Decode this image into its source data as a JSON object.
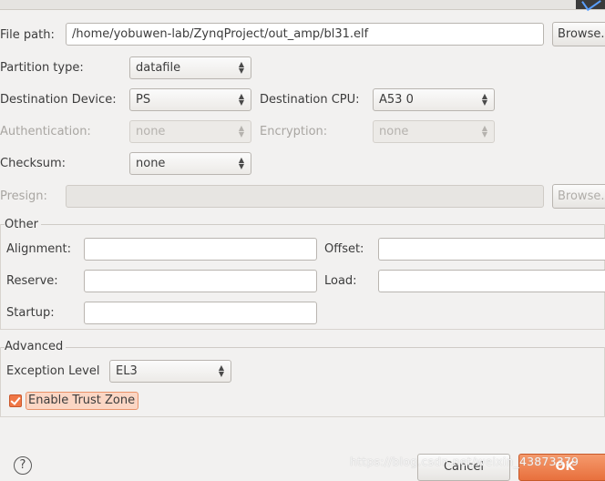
{
  "file_path": {
    "label": "File path:",
    "value": "/home/yobuwen-lab/ZynqProject/out_amp/bl31.elf",
    "browse": "Browse."
  },
  "partition_type": {
    "label": "Partition type:",
    "value": "datafile"
  },
  "destination_device": {
    "label": "Destination Device:",
    "value": "PS"
  },
  "destination_cpu": {
    "label": "Destination CPU:",
    "value": "A53 0"
  },
  "authentication": {
    "label": "Authentication:",
    "value": "none"
  },
  "encryption": {
    "label": "Encryption:",
    "value": "none"
  },
  "checksum": {
    "label": "Checksum:",
    "value": "none"
  },
  "presign": {
    "label": "Presign:",
    "value": "",
    "browse": "Browse."
  },
  "other": {
    "title": "Other",
    "alignment_label": "Alignment:",
    "offset_label": "Offset:",
    "reserve_label": "Reserve:",
    "load_label": "Load:",
    "startup_label": "Startup:"
  },
  "advanced": {
    "title": "Advanced",
    "exception_level_label": "Exception Level",
    "exception_level_value": "EL3",
    "trust_zone_label": "Enable Trust Zone",
    "trust_zone_checked": true
  },
  "footer": {
    "help": "?",
    "cancel": "Cancel",
    "ok": "OK"
  },
  "watermark": "https://blog.csdn.net/weixin_43873379",
  "icons": {
    "spin": "up-down-arrows-icon",
    "help": "help-icon",
    "check": "checkmark-icon"
  }
}
